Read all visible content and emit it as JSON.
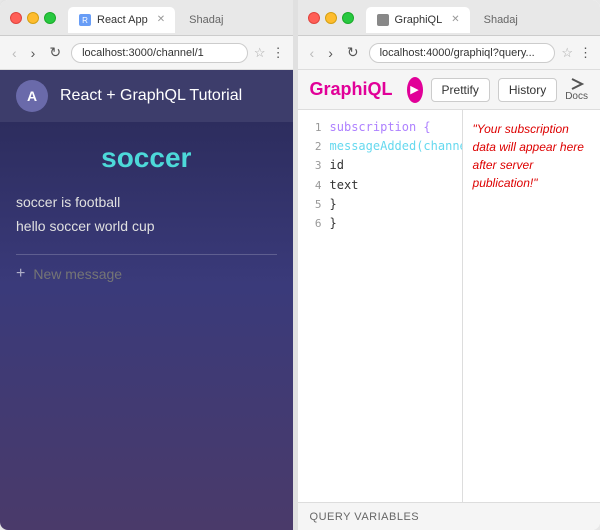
{
  "left": {
    "window": {
      "tab_label": "React App",
      "tab_extra": "Shadaj",
      "url": "localhost:3000/channel/1"
    },
    "header": {
      "avatar": "A",
      "title": "React + GraphQL Tutorial"
    },
    "channel": {
      "name": "soccer",
      "messages": [
        {
          "text": "soccer is football"
        },
        {
          "text": "hello soccer world cup"
        }
      ],
      "new_message_placeholder": "New message"
    }
  },
  "right": {
    "window": {
      "tab_label": "GraphiQL",
      "tab_extra": "Shadaj",
      "url": "localhost:4000/graphiql?query..."
    },
    "toolbar": {
      "title": "GraphiQL",
      "run_icon": "▶",
      "prettify_label": "Prettify",
      "history_label": "History",
      "docs_label": "Docs"
    },
    "editor": {
      "lines": [
        {
          "num": "1",
          "content": "subscription {",
          "type": "keyword"
        },
        {
          "num": "2",
          "content": "  messageAdded(channe",
          "type": "field"
        },
        {
          "num": "3",
          "content": "    id",
          "type": "plain"
        },
        {
          "num": "4",
          "content": "    text",
          "type": "plain"
        },
        {
          "num": "5",
          "content": "  }",
          "type": "plain"
        },
        {
          "num": "6",
          "content": "}",
          "type": "plain"
        }
      ]
    },
    "result": {
      "text": "\"Your subscription data will appear here after server publication!\""
    },
    "query_variables_label": "QUERY VARIABLES"
  }
}
